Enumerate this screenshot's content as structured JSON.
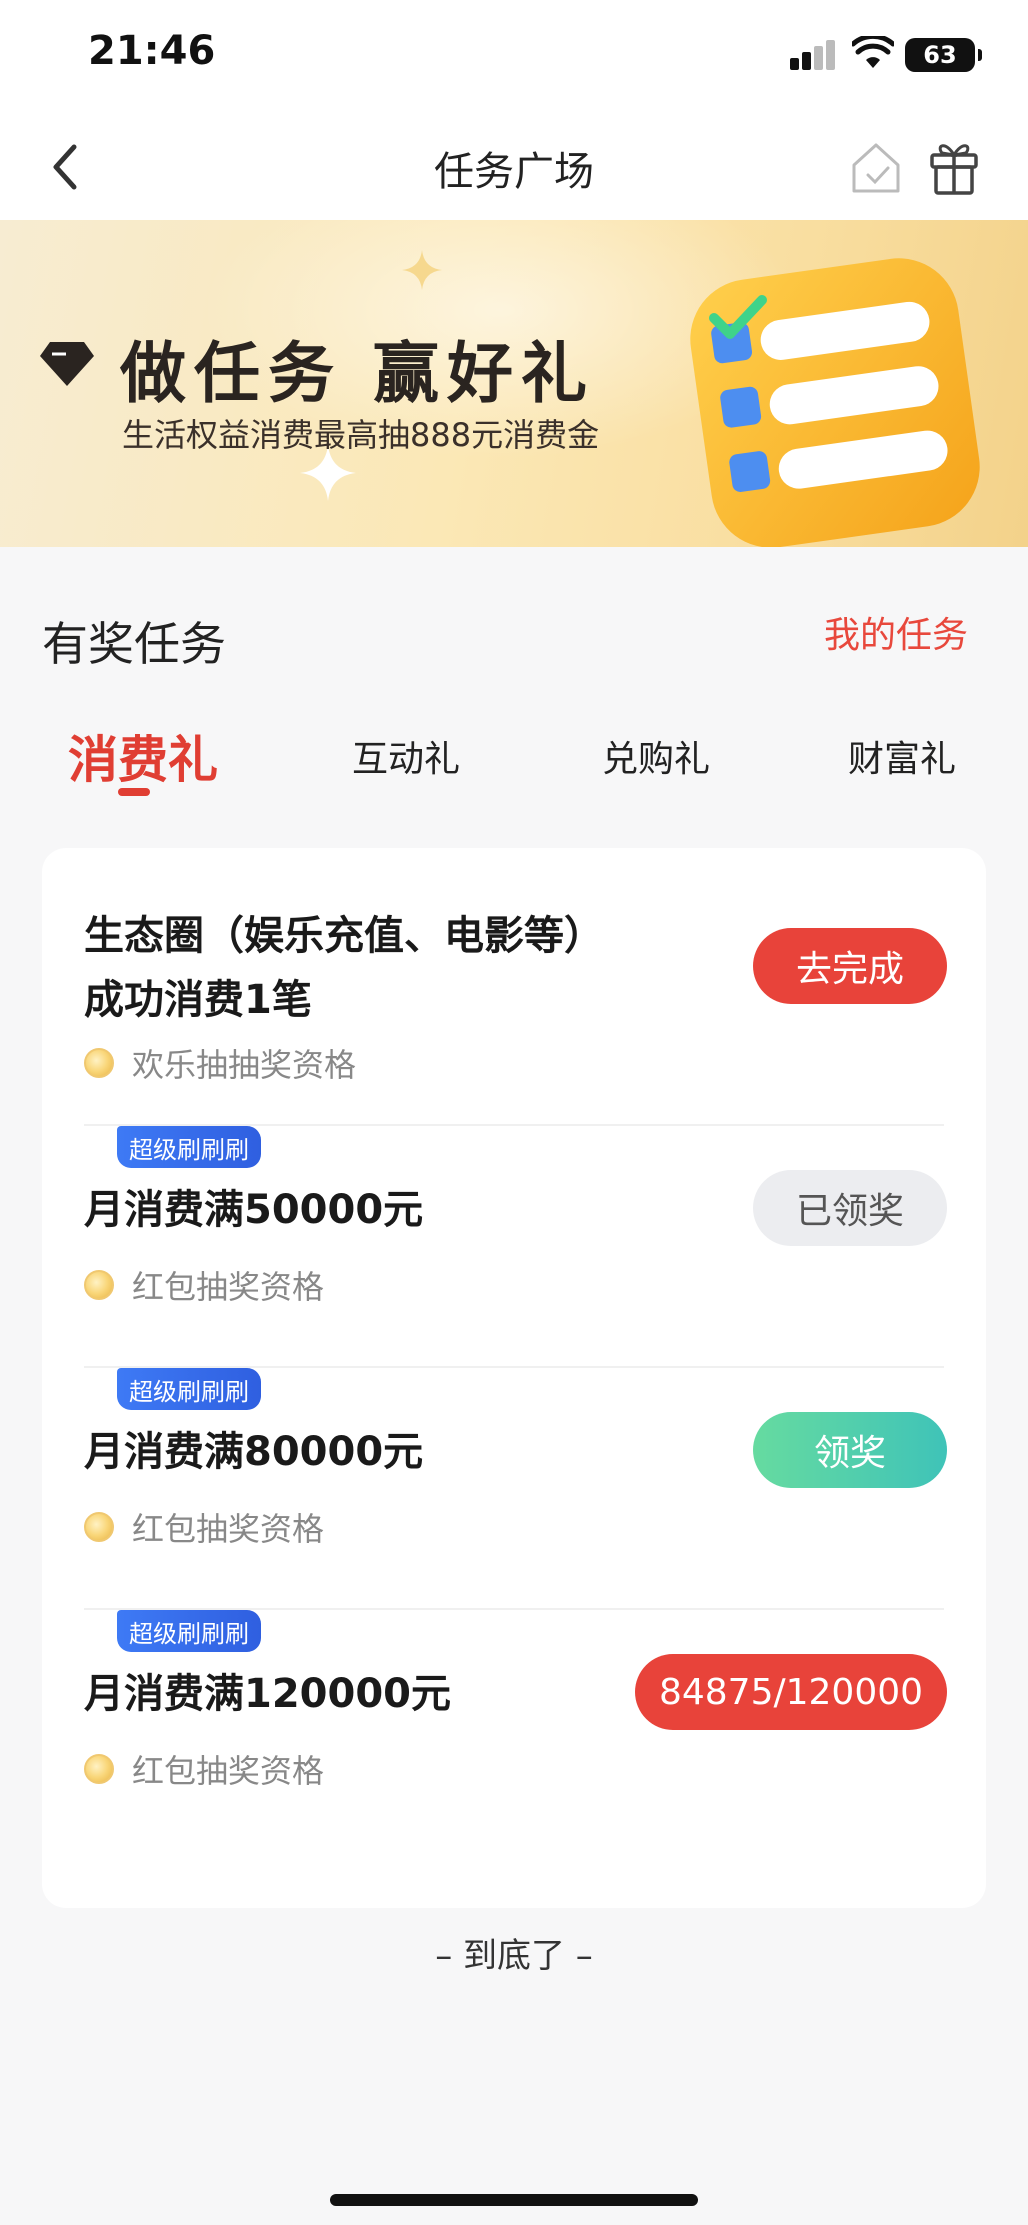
{
  "status_bar": {
    "time": "21:46",
    "battery": "63"
  },
  "nav": {
    "title": "任务广场"
  },
  "banner": {
    "title": "做任务 赢好礼",
    "subtitle": "生活权益消费最高抽888元消费金"
  },
  "section": {
    "title": "有奖任务",
    "my_tasks": "我的任务"
  },
  "tabs": [
    "消费礼",
    "互动礼",
    "兑购礼",
    "财富礼"
  ],
  "tasks": [
    {
      "tag": "",
      "title_line1": "生态圈（娱乐充值、电影等）",
      "title_line2": "成功消费1笔",
      "reward": "欢乐抽抽奖资格",
      "button": "去完成"
    },
    {
      "tag": "超级刷刷刷",
      "title_line1": "月消费满50000元",
      "title_line2": "",
      "reward": "红包抽奖资格",
      "button": "已领奖"
    },
    {
      "tag": "超级刷刷刷",
      "title_line1": "月消费满80000元",
      "title_line2": "",
      "reward": "红包抽奖资格",
      "button": "领奖"
    },
    {
      "tag": "超级刷刷刷",
      "title_line1": "月消费满120000元",
      "title_line2": "",
      "reward": "红包抽奖资格",
      "button": "84875/120000"
    }
  ],
  "footer": {
    "end_text": "– 到底了 –"
  },
  "colors": {
    "accent_red": "#e8433a",
    "tag_blue": "#3e7af5",
    "claim_green": "#4fcfae"
  }
}
